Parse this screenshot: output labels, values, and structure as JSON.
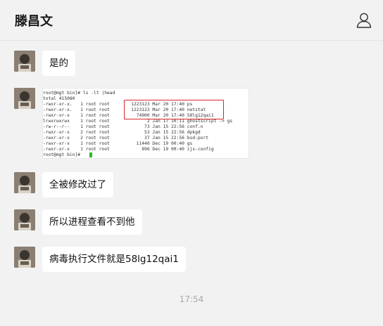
{
  "header": {
    "title": "滕昌文",
    "contact_icon": "person-outline-icon"
  },
  "messages": [
    {
      "type": "text",
      "text": "是的"
    },
    {
      "type": "image",
      "terminal_lines": [
        "root@mgt bin]# ls -lt |head",
        "total 415080",
        "-rwxr-xr-x.   1 root root        1223123 Mar 20 17:40 ps",
        "-rwxr-xr-x.   1 root root        1223123 Mar 20 17:40 netstat",
        "-rwxr-xr-x    1 root root          74900 Mar 20 17:40 58lg12qai1",
        "lrwxrwxrwx    1 root root              2 Jan 17 10:11 ghostscript -> gs",
        "-rw-r--r--    1 root root             73 Jan 15 22:56 conf.n",
        "-rwxr-xr-x    2 root root             53 Jan 15 22:56 dpkgd",
        "-rwxr-xr-x    2 root root             37 Jan 15 22:56 bsd-port",
        "-rwxr-xr-x    1 root root          11440 Dec 19 00:40 gs",
        "-rwxr-xr-x    1 root root            896 Dec 19 00:40 ijs-config",
        "root@mgt bin]# "
      ]
    },
    {
      "type": "text",
      "text": "全被修改过了"
    },
    {
      "type": "text",
      "text": "所以进程查看不到他"
    },
    {
      "type": "text",
      "text": "病毒执行文件就是58lg12qai1"
    }
  ],
  "timestamp": "17:54",
  "colors": {
    "background": "#f2f2f2",
    "bubble": "#ffffff",
    "highlight_box": "#d9252b",
    "cursor": "#20c020"
  }
}
